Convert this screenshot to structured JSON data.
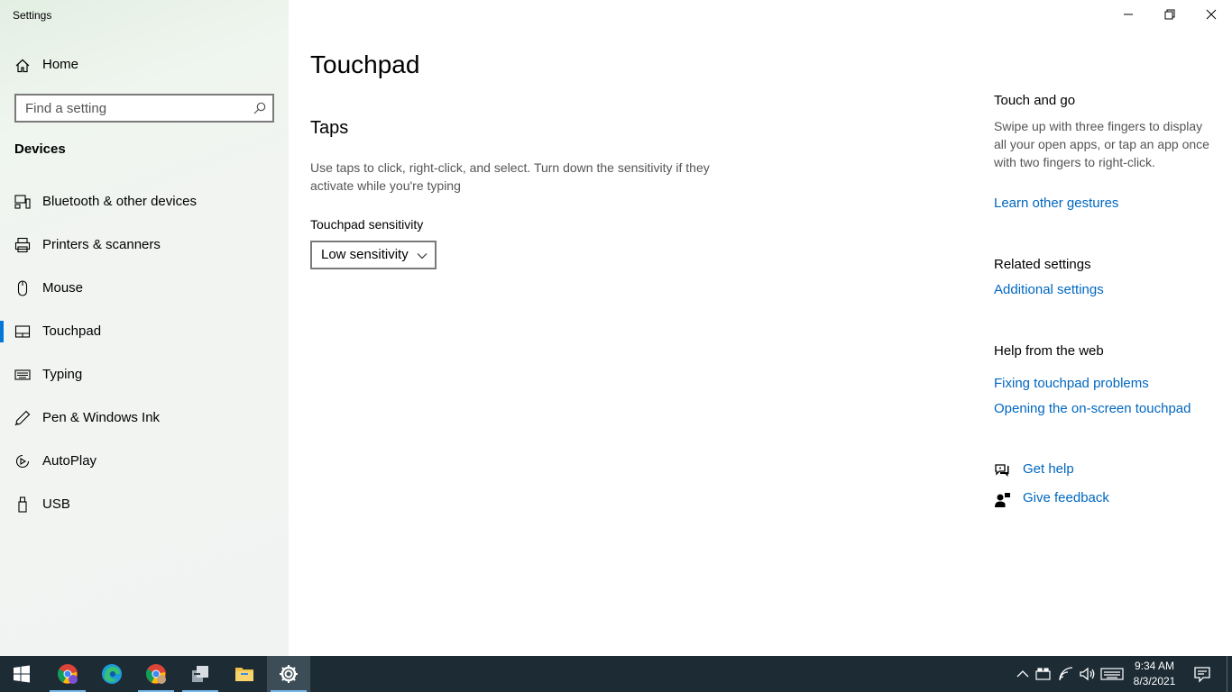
{
  "window": {
    "title": "Settings"
  },
  "sidebar": {
    "home_label": "Home",
    "search_placeholder": "Find a setting",
    "section": "Devices",
    "items": [
      {
        "label": "Bluetooth & other devices",
        "icon": "bluetooth-devices-icon"
      },
      {
        "label": "Printers & scanners",
        "icon": "printer-icon"
      },
      {
        "label": "Mouse",
        "icon": "mouse-icon"
      },
      {
        "label": "Touchpad",
        "icon": "touchpad-icon",
        "active": true
      },
      {
        "label": "Typing",
        "icon": "keyboard-icon"
      },
      {
        "label": "Pen & Windows Ink",
        "icon": "pen-icon"
      },
      {
        "label": "AutoPlay",
        "icon": "autoplay-icon"
      },
      {
        "label": "USB",
        "icon": "usb-icon"
      }
    ]
  },
  "main": {
    "title": "Touchpad",
    "taps": {
      "heading": "Taps",
      "description": "Use taps to click, right-click, and select. Turn down the sensitivity if they activate while you're typing",
      "sensitivity_label": "Touchpad sensitivity",
      "sensitivity_value": "Low sensitivity"
    }
  },
  "right": {
    "touch_and_go": {
      "heading": "Touch and go",
      "text": "Swipe up with three fingers to display all your open apps, or tap an app once with two fingers to right-click.",
      "link": "Learn other gestures"
    },
    "related": {
      "heading": "Related settings",
      "link": "Additional settings"
    },
    "help_web": {
      "heading": "Help from the web",
      "links": [
        "Fixing touchpad problems",
        "Opening the on-screen touchpad"
      ]
    },
    "get_help": "Get help",
    "give_feedback": "Give feedback"
  },
  "taskbar": {
    "apps": [
      "start",
      "chrome-profile",
      "edge",
      "chrome-user",
      "app",
      "file-explorer",
      "settings"
    ],
    "time": "9:34 AM",
    "date": "8/3/2021"
  },
  "colors": {
    "accent": "#0078d4",
    "link": "#0067c0",
    "taskbar": "#1c2b34"
  }
}
